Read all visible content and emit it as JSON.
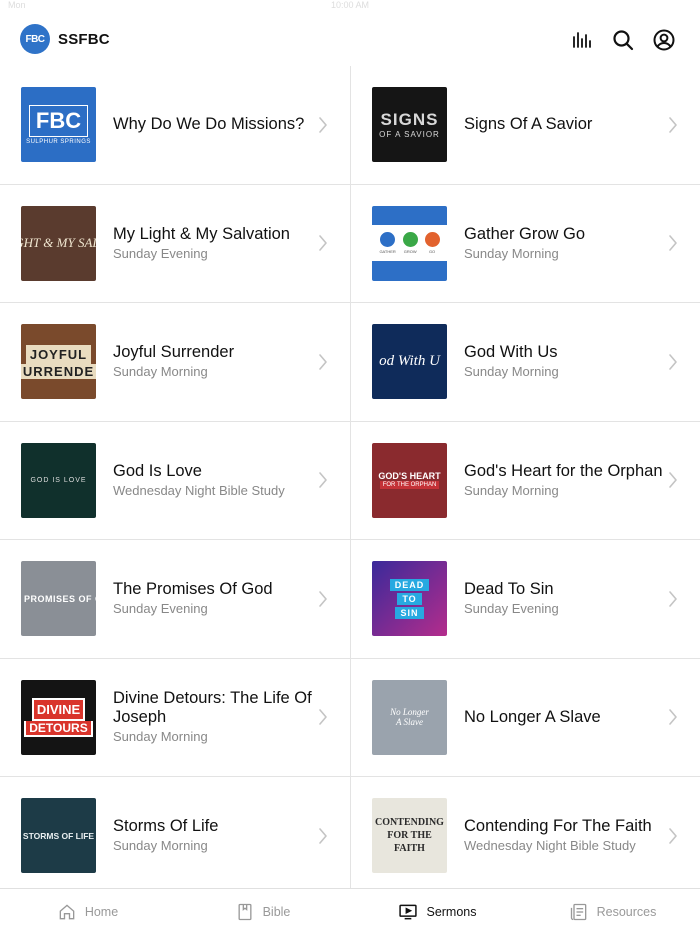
{
  "status": {
    "time": "Mon",
    "center": "10:00 AM"
  },
  "header": {
    "logo_text": "FBC",
    "brand": "SSFBC",
    "icons": [
      "audio-bars-icon",
      "search-icon",
      "account-icon"
    ]
  },
  "sermons": [
    {
      "title": "Why Do We Do Missions?",
      "subtitle": "",
      "thumb": {
        "bg": "#2c6ec5",
        "text": "FBC",
        "sub": "SULPHUR SPRINGS"
      }
    },
    {
      "title": "Signs Of A Savior",
      "subtitle": "",
      "thumb": {
        "bg": "#151515",
        "text": "SIGNS",
        "sub": "OF A SAVIOR"
      }
    },
    {
      "title": "My Light & My Salvation",
      "subtitle": "Sunday Evening",
      "thumb": {
        "bg": "#5a3b2e",
        "text": "IGHT & MY SALV"
      }
    },
    {
      "title": "Gather Grow Go",
      "subtitle": "Sunday Morning",
      "thumb": {
        "bg": "#2d6fc6",
        "labels": [
          "GATHER",
          "GROW",
          "GO"
        ]
      }
    },
    {
      "title": "Joyful Surrender",
      "subtitle": "Sunday Morning",
      "thumb": {
        "bg": "#7a4a2c",
        "text": "JOYFUL",
        "sub": "URRENDE"
      }
    },
    {
      "title": "God With Us",
      "subtitle": "Sunday Morning",
      "thumb": {
        "bg": "#0f2b5a",
        "text": "od With U"
      }
    },
    {
      "title": "God Is Love",
      "subtitle": "Wednesday Night Bible Study",
      "thumb": {
        "bg": "#10302c",
        "text": "GOD IS LOVE"
      }
    },
    {
      "title": "God's Heart for the Orphan",
      "subtitle": "Sunday Morning",
      "thumb": {
        "bg": "#8a2a2e",
        "text": "GOD'S HEART",
        "sub": "FOR THE ORPHAN"
      }
    },
    {
      "title": "The Promises Of God",
      "subtitle": "Sunday Evening",
      "thumb": {
        "bg": "#8a8f96",
        "text": "E PROMISES OF G"
      }
    },
    {
      "title": "Dead To Sin",
      "subtitle": "Sunday Evening",
      "thumb": {
        "bg": "#6a2c8a",
        "words": [
          "DEAD",
          "TO",
          "SIN"
        ]
      }
    },
    {
      "title": "Divine Detours: The Life Of Joseph",
      "subtitle": "Sunday Morning",
      "thumb": {
        "bg": "#141414",
        "text": "DIVINE",
        "sub": "DETOURS"
      }
    },
    {
      "title": "No Longer A Slave",
      "subtitle": "",
      "thumb": {
        "bg": "#9aa3ad",
        "text": "No Longer",
        "sub": "A Slave"
      }
    },
    {
      "title": "Storms Of Life",
      "subtitle": "Sunday Morning",
      "thumb": {
        "bg": "#1d3b47",
        "text": "STORMS OF LIFE"
      }
    },
    {
      "title": "Contending For The Faith",
      "subtitle": "Wednesday Night Bible Study",
      "thumb": {
        "bg": "#e8e6dd",
        "text": "CONTENDING FOR THE FAITH"
      }
    }
  ],
  "tabs": [
    {
      "label": "Home",
      "icon": "home-icon",
      "active": false
    },
    {
      "label": "Bible",
      "icon": "book-icon",
      "active": false
    },
    {
      "label": "Sermons",
      "icon": "tv-play-icon",
      "active": true
    },
    {
      "label": "Resources",
      "icon": "document-icon",
      "active": false
    }
  ]
}
